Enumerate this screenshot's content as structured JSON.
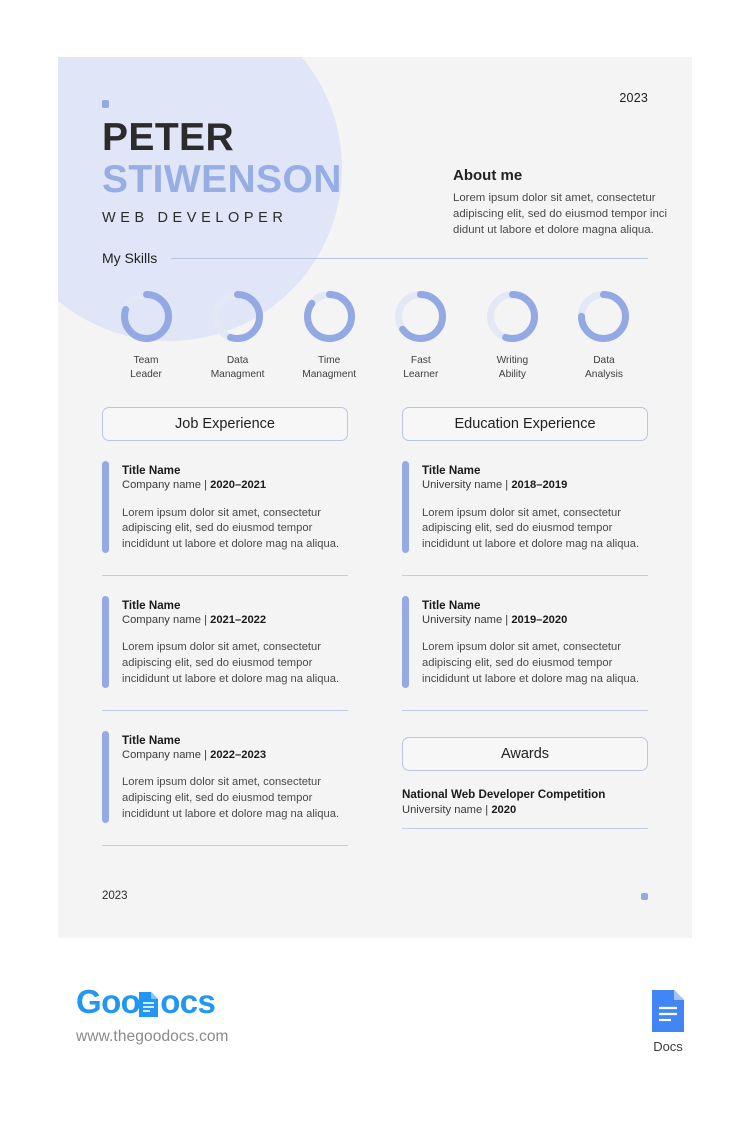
{
  "document": {
    "year_top": "2023",
    "year_bottom": "2023"
  },
  "header": {
    "first_name": "PETER",
    "last_name": "STIWENSON",
    "job_title": "WEB DEVELOPER",
    "accent_color": "#97aee4",
    "blob_color": "#e0e6f7"
  },
  "about": {
    "title": "About me",
    "text": "Lorem ipsum dolor sit amet, consectetur adipiscing elit, sed do eiusmod tempor inci didunt ut labore et dolore magna aliqua."
  },
  "skills": {
    "heading": "My Skills",
    "items": [
      {
        "label_line1": "Team",
        "label_line2": "Leader",
        "percent": 80
      },
      {
        "label_line1": "Data",
        "label_line2": "Managment",
        "percent": 55
      },
      {
        "label_line1": "Time",
        "label_line2": "Managment",
        "percent": 85
      },
      {
        "label_line1": "Fast",
        "label_line2": "Learner",
        "percent": 65
      },
      {
        "label_line1": "Writing",
        "label_line2": "Ability",
        "percent": 55
      },
      {
        "label_line1": "Data",
        "label_line2": "Analysis",
        "percent": 75
      }
    ]
  },
  "job_experience": {
    "heading": "Job Experience",
    "entries": [
      {
        "title": "Title Name",
        "org": "Company name | ",
        "dates": "2020–2021",
        "desc": "Lorem ipsum dolor sit amet, consectetur adipiscing elit, sed do eiusmod tempor incididunt ut labore et dolore mag na aliqua."
      },
      {
        "title": "Title Name",
        "org": "Company name | ",
        "dates": "2021–2022",
        "desc": "Lorem ipsum dolor sit amet, consectetur adipiscing elit, sed do eiusmod tempor incididunt ut labore et dolore mag na aliqua."
      },
      {
        "title": "Title Name",
        "org": "Company name | ",
        "dates": "2022–2023",
        "desc": "Lorem ipsum dolor sit amet, consectetur adipiscing elit, sed do eiusmod tempor incididunt ut labore et dolore mag na aliqua."
      }
    ]
  },
  "education_experience": {
    "heading": "Education Experience",
    "entries": [
      {
        "title": "Title Name",
        "org": "University name | ",
        "dates": "2018–2019",
        "desc": "Lorem ipsum dolor sit amet, consectetur adipiscing elit, sed do eiusmod tempor incididunt ut labore et dolore mag na aliqua."
      },
      {
        "title": "Title Name",
        "org": "University name | ",
        "dates": "2019–2020",
        "desc": "Lorem ipsum dolor sit amet, consectetur adipiscing elit, sed do eiusmod tempor incididunt ut labore et dolore mag na aliqua."
      }
    ]
  },
  "awards": {
    "heading": "Awards",
    "entries": [
      {
        "title": "National Web Developer Competition",
        "org": "University name | ",
        "dates": "2020"
      }
    ]
  },
  "brand": {
    "name_part1": "Goo",
    "name_part2": "ocs",
    "url": "www.thegoodocs.com",
    "docs_label": "Docs",
    "logo_color": "#2196f3",
    "docs_icon_color": "#4285f4"
  }
}
